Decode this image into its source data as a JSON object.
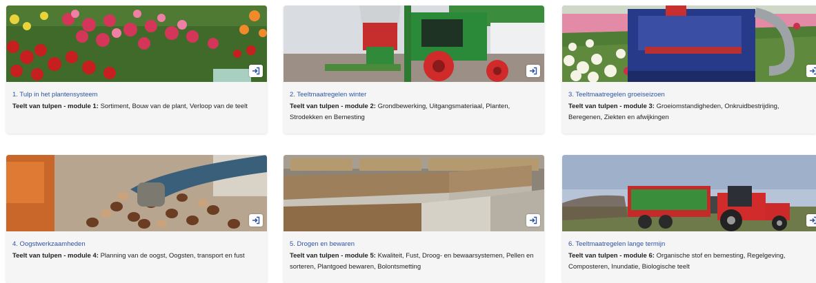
{
  "cards": [
    {
      "title": "1. Tulp in het plantensysteem",
      "module": "Teelt van tulpen - module 1:",
      "topics": "Sortiment, Bouw van de plant, Verloop van de teelt",
      "image": "tulip-field-photo",
      "button_icon": "enter-icon"
    },
    {
      "title": "2. Teeltmaatregelen winter",
      "module": "Teelt van tulpen - module 2:",
      "topics": "Grondbewerking, Uitgangsmateriaal, Planten, Strodekken en Bemesting",
      "image": "green-tractor-planter-photo",
      "button_icon": "enter-icon"
    },
    {
      "title": "3. Teeltmaatregelen groeiseizoen",
      "module": "Teelt van tulpen - module 3:",
      "topics": "Groeiomstandigheden, Onkruidbestrijding, Beregenen, Ziekten en afwijkingen",
      "image": "blue-harvester-photo",
      "button_icon": "enter-icon"
    },
    {
      "title": "4. Oogstwerkzaamheden",
      "module": "Teelt van tulpen - module 4:",
      "topics": "Planning van de oogst, Oogsten, transport en fust",
      "image": "bulb-harvest-photo",
      "button_icon": "enter-icon"
    },
    {
      "title": "5. Drogen en bewaren",
      "module": "Teelt van tulpen - module 5:",
      "topics": "Kwaliteit, Fust, Droog- en bewaarsystemen, Pellen en sorteren, Plantgoed bewaren, Bolontsmetting",
      "image": "bulb-storage-crates-photo",
      "button_icon": "enter-icon"
    },
    {
      "title": "6. Teeltmaatregelen lange termijn",
      "module": "Teelt van tulpen - module 6:",
      "topics": "Organische stof en bemesting, Regelgeving, Composteren, Inundatie, Biologische teelt",
      "image": "red-tractor-spreader-photo",
      "button_icon": "enter-icon"
    }
  ]
}
